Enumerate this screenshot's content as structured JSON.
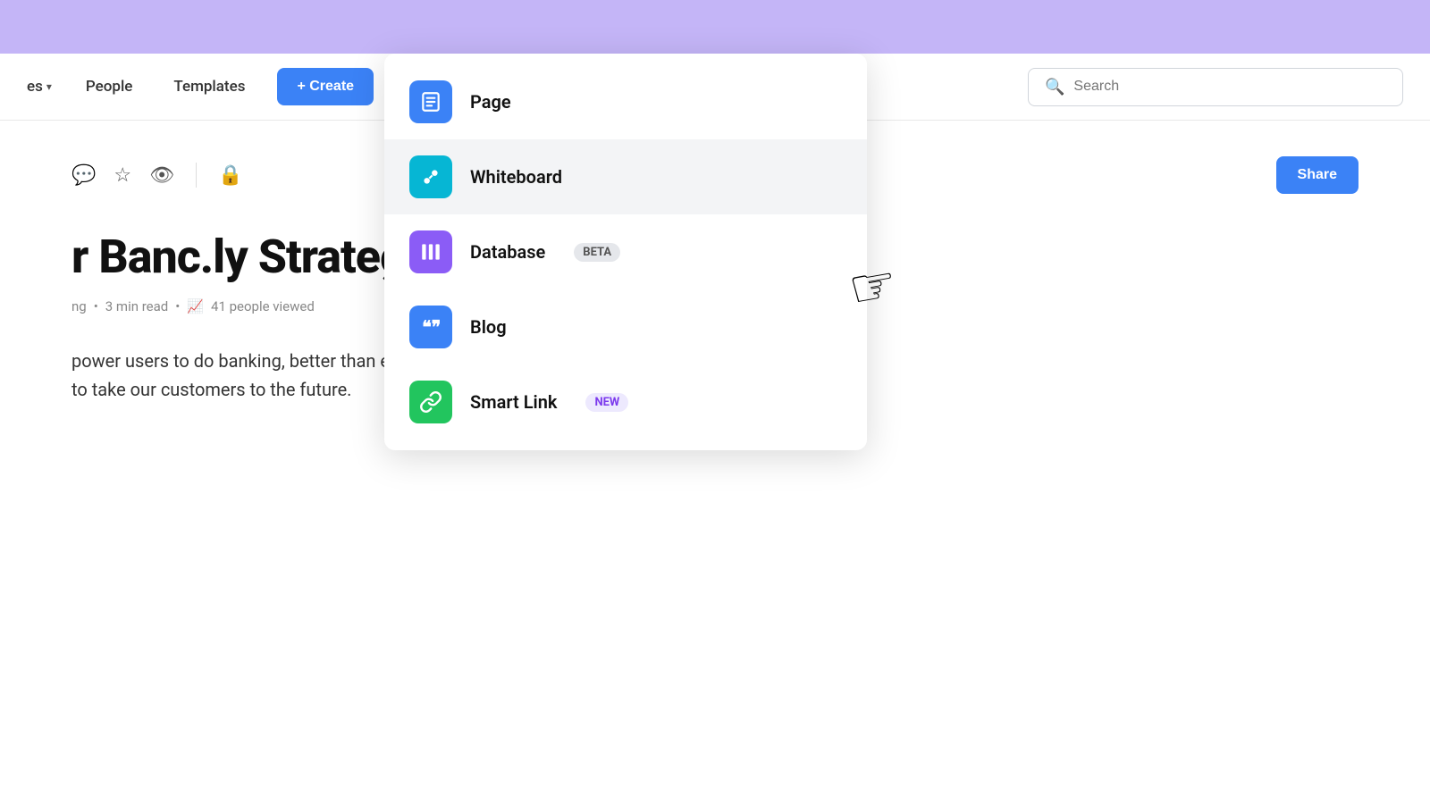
{
  "topBanner": {},
  "navbar": {
    "spacesLabel": "es",
    "peopleLabel": "People",
    "templatesLabel": "Templates",
    "createLabel": "+ Create",
    "searchPlaceholder": "Search"
  },
  "toolbar": {
    "shareLabel": "Share"
  },
  "page": {
    "title": "r Banc.ly Strategy",
    "metaAuthor": "ng",
    "metaRead": "3 min read",
    "metaViews": "41 people viewed",
    "body1": "power users to do banking, better than ever. We are a credit card company",
    "body2": "to take our customers to the future."
  },
  "dropdown": {
    "items": [
      {
        "id": "page",
        "label": "Page",
        "iconClass": "icon-page",
        "badge": null,
        "badgeType": null
      },
      {
        "id": "whiteboard",
        "label": "Whiteboard",
        "iconClass": "icon-whiteboard",
        "badge": null,
        "badgeType": null
      },
      {
        "id": "database",
        "label": "Database",
        "iconClass": "icon-database",
        "badge": "BETA",
        "badgeType": "beta"
      },
      {
        "id": "blog",
        "label": "Blog",
        "iconClass": "icon-blog",
        "badge": null,
        "badgeType": null
      },
      {
        "id": "smartlink",
        "label": "Smart Link",
        "iconClass": "icon-smartlink",
        "badge": "NEW",
        "badgeType": "new"
      }
    ]
  }
}
